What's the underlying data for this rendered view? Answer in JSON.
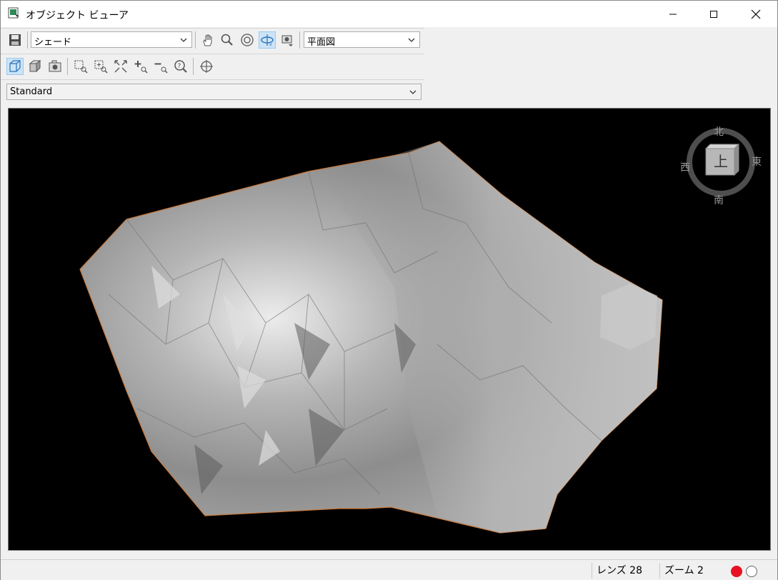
{
  "window": {
    "title": "オブジェクト ビューア",
    "icon": "object-viewer-app-icon"
  },
  "window_buttons": [
    "minimize",
    "maximize",
    "close"
  ],
  "toolbar1": {
    "render_mode": "シェード",
    "view_mode": "平面図",
    "buttons": [
      "save-icon",
      "pan-hand-icon",
      "zoom-icon",
      "orbit-target-icon",
      "rotate-x-icon",
      "camera-view-icon"
    ]
  },
  "toolbar2": {
    "buttons": [
      "wireframe-box-icon",
      "solid-box-icon",
      "camera-icon",
      "zoom-window-icon",
      "zoom-center-icon",
      "zoom-extents-icon",
      "zoom-in-icon",
      "zoom-out-icon",
      "zoom-help-icon",
      "target-crosshair-icon"
    ]
  },
  "style_select": "Standard",
  "compass": {
    "north": "北",
    "south": "南",
    "east": "東",
    "west": "西",
    "face": "上"
  },
  "status": {
    "lens": "レンズ 28",
    "zoom": "ズーム 2"
  },
  "colors": {
    "viewport_bg": "#000000",
    "terrain": "#a8a8a8",
    "accent_active": "#cce4f7",
    "record_red": "#e81123"
  }
}
